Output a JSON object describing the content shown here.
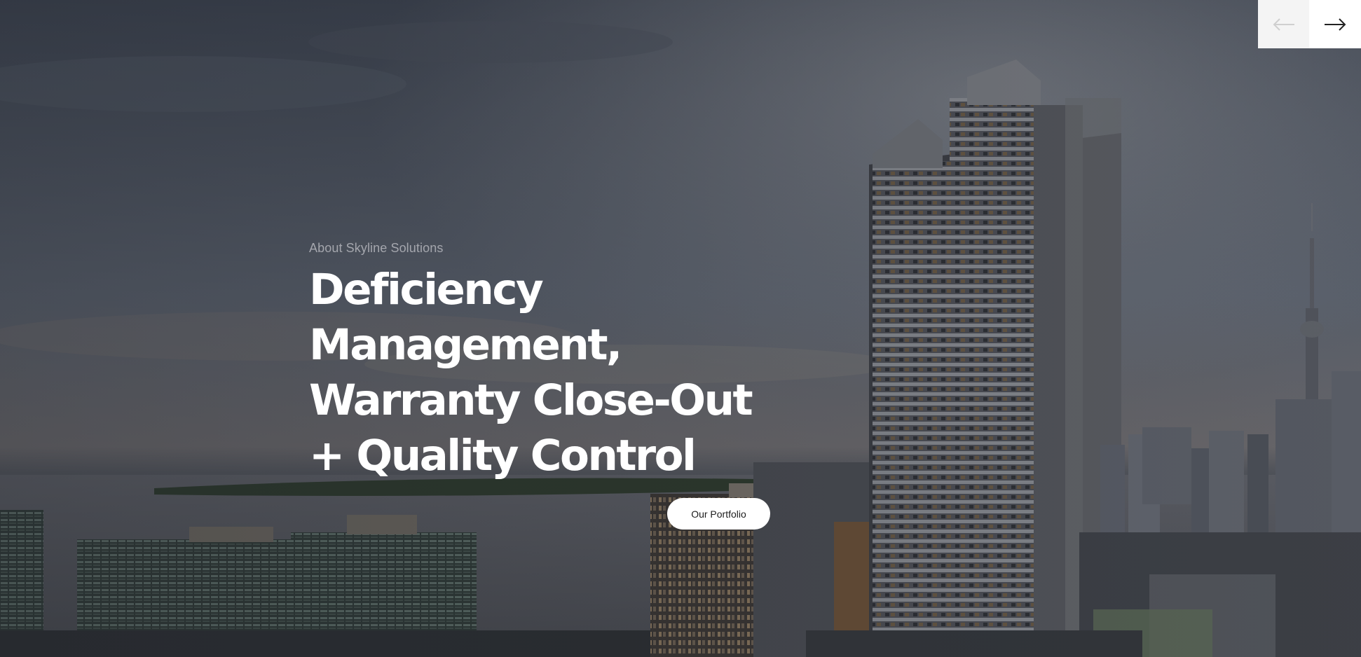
{
  "hero": {
    "background_image": "waterfront-skyline-rendering",
    "eyebrow": "About Skyline Solutions",
    "headline": "Deficiency Management, Warranty Close-Out + Quality Control",
    "cta_label": "Our Portfolio"
  },
  "slider": {
    "prev_icon": "arrow-left-icon",
    "next_icon": "arrow-right-icon"
  },
  "colors": {
    "text_primary": "#ffffff",
    "text_muted": "#a4a6ad",
    "button_bg": "#ffffff",
    "button_text": "#1c1c1c",
    "arrow_disabled": "#cfcfcf",
    "arrow_active": "#222222"
  }
}
